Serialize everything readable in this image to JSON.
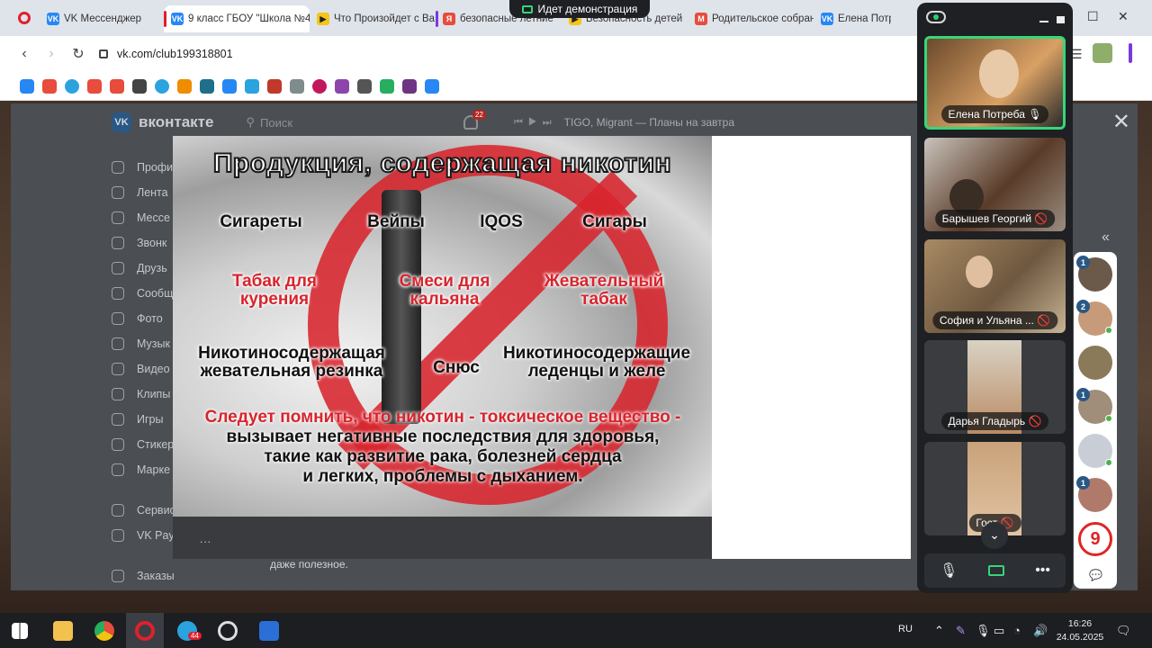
{
  "browser": {
    "tabs": [
      {
        "label": "VK Мессенджер",
        "color": "#2787f5"
      },
      {
        "label": "9 класс ГБОУ \"Школа №4",
        "color": "#2787f5"
      },
      {
        "label": "Что Произойдет с Ва",
        "color": "#f5c518"
      },
      {
        "label": "безопасные летние",
        "color": "#e74c3c"
      },
      {
        "label": "Безопасность детей",
        "color": "#f5c518"
      },
      {
        "label": "Родительское собран",
        "color": "#e74c3c"
      },
      {
        "label": "Елена Потре",
        "color": "#2787f5"
      }
    ],
    "url": "vk.com/club199318801"
  },
  "demo_banner": "Идет демонстрация",
  "vk": {
    "brand": "вконтакте",
    "search_placeholder": "Поиск",
    "notifications": "22",
    "now_playing": "TIGO, Migrant — Планы на завтра",
    "menu": [
      "Профи",
      "Лента",
      "Мессе",
      "Звонк",
      "Друзь",
      "Сообщ",
      "Фото",
      "Музык",
      "Видео",
      "Клипы",
      "Игры",
      "Стикер",
      "Марке"
    ],
    "menu2": [
      "Сервис",
      "VK Pay"
    ],
    "menu3": [
      "Заказы"
    ],
    "post_text": "даже полезное."
  },
  "slide": {
    "title": "Продукция, содержащая никотин",
    "items": [
      {
        "text": "Сигареты",
        "style": "blk"
      },
      {
        "text": "Вейпы",
        "style": "blk"
      },
      {
        "text": "IQOS",
        "style": "blk"
      },
      {
        "text": "Сигары",
        "style": "blk"
      },
      {
        "text": "Табак для курения",
        "style": "red"
      },
      {
        "text": "Смеси для кальяна",
        "style": "red"
      },
      {
        "text": "Жевательный табак",
        "style": "red"
      },
      {
        "text": "Никотиносодержащая жевательная резинка",
        "style": "blk"
      },
      {
        "text": "Снюс",
        "style": "blk"
      },
      {
        "text": "Никотиносодержащие леденцы и желе",
        "style": "blk"
      }
    ],
    "warning_red": "Следует помнить, что никотин - токсическое вещество -",
    "warning_black_1": "вызывает негативные последствия для здоровья,",
    "warning_black_2": "такие как развитие рака, болезней сердца",
    "warning_black_3": "и легких, проблемы с дыханием.",
    "controls": "..."
  },
  "conference": {
    "participants": [
      {
        "name": "Елена Потреба",
        "mic": "on"
      },
      {
        "name": "Барышев Георгий",
        "mic": "off"
      },
      {
        "name": "София и Ульяна ...",
        "mic": "off"
      },
      {
        "name": "Дарья Гладырь",
        "mic": "off"
      },
      {
        "name": "Гост",
        "mic": "off"
      }
    ]
  },
  "sidebar_counts": [
    "1",
    "2",
    "",
    "1",
    "",
    "1",
    ""
  ],
  "taskbar": {
    "lang": "RU",
    "time": "16:26",
    "date": "24.05.2025",
    "telegram_badge": "44"
  }
}
